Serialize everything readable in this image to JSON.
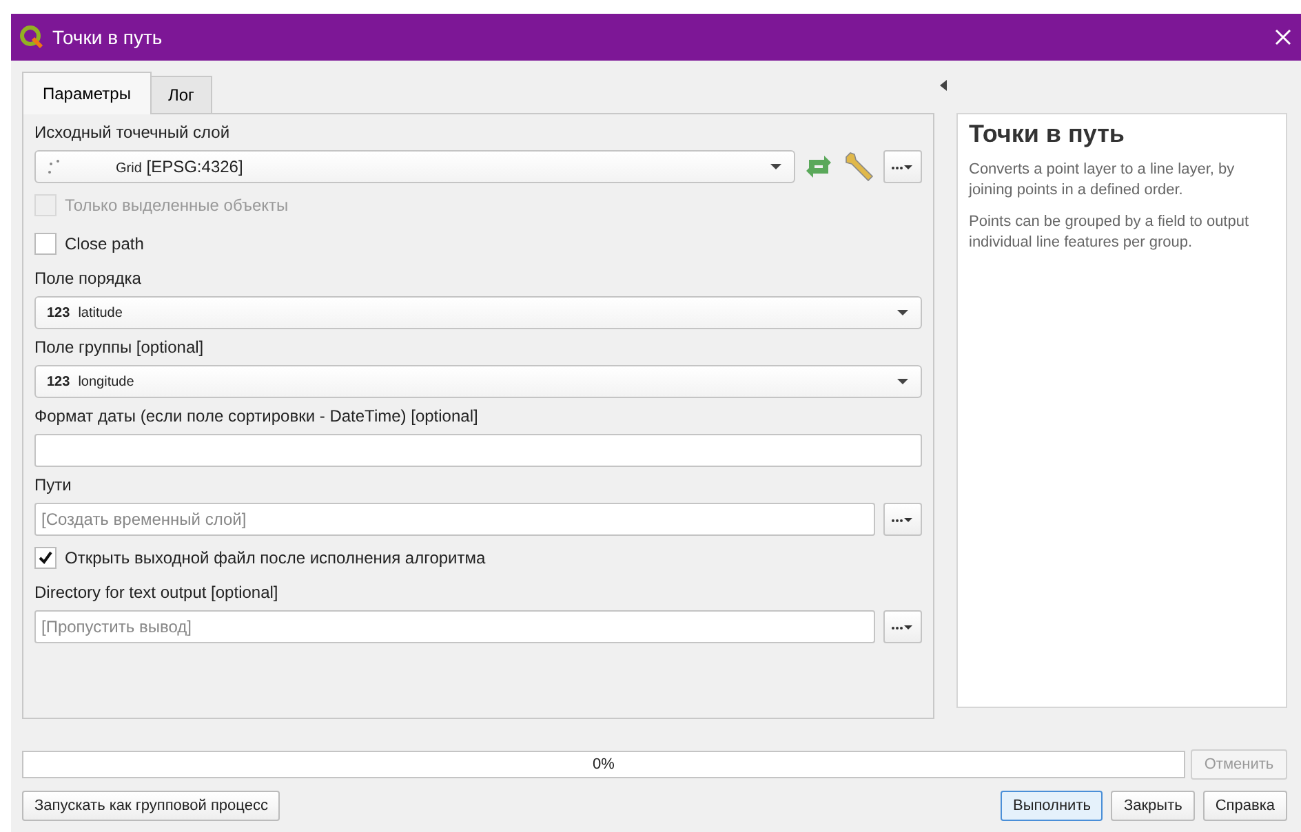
{
  "window": {
    "title": "Точки в путь"
  },
  "tabs": [
    {
      "label": "Параметры",
      "selected": true
    },
    {
      "label": "Лог",
      "selected": false
    }
  ],
  "parameters": [
    {
      "kind": "label",
      "text": "Исходный точечный слой"
    },
    {
      "kind": "layer",
      "value": "Grid",
      "crs": "[EPSG:4326]"
    },
    {
      "kind": "checkbox",
      "label": "Только выделенные объекты",
      "checked": false,
      "disabled": true
    },
    {
      "kind": "checkbox",
      "label": "Close path",
      "checked": false,
      "disabled": false
    },
    {
      "kind": "label",
      "text": "Поле порядка"
    },
    {
      "kind": "field",
      "type_label": "123",
      "value": "latitude"
    },
    {
      "kind": "label",
      "text": "Поле группы [optional]"
    },
    {
      "kind": "field",
      "type_label": "123",
      "value": "longitude"
    },
    {
      "kind": "label",
      "text": "Формат даты (если поле сортировки - DateTime) [optional]"
    },
    {
      "kind": "text"
    },
    {
      "kind": "label",
      "text": "Пути"
    },
    {
      "kind": "output",
      "placeholder": "[Создать временный слой]"
    },
    {
      "kind": "checkbox",
      "label": "Открыть выходной файл после исполнения алгоритма",
      "checked": true,
      "disabled": false
    },
    {
      "kind": "label",
      "text": "Directory for text output [optional]"
    },
    {
      "kind": "output",
      "placeholder": "[Пропустить вывод]"
    }
  ],
  "help": {
    "title": "Точки в путь",
    "paragraphs": [
      "Converts a point layer to a line layer, by joining points in a defined order.",
      "Points can be grouped by a field to output individual line features per group."
    ]
  },
  "progress": {
    "level": 0,
    "text": "0%"
  },
  "cancel_button": {
    "label": "Отменить",
    "disabled": true
  },
  "batch_button": {
    "label": "Запускать как групповой процесс"
  },
  "buttons": [
    {
      "label": "Выполнить",
      "selected": true
    },
    {
      "label": "Закрыть",
      "selected": false
    },
    {
      "label": "Справка",
      "selected": false
    }
  ]
}
